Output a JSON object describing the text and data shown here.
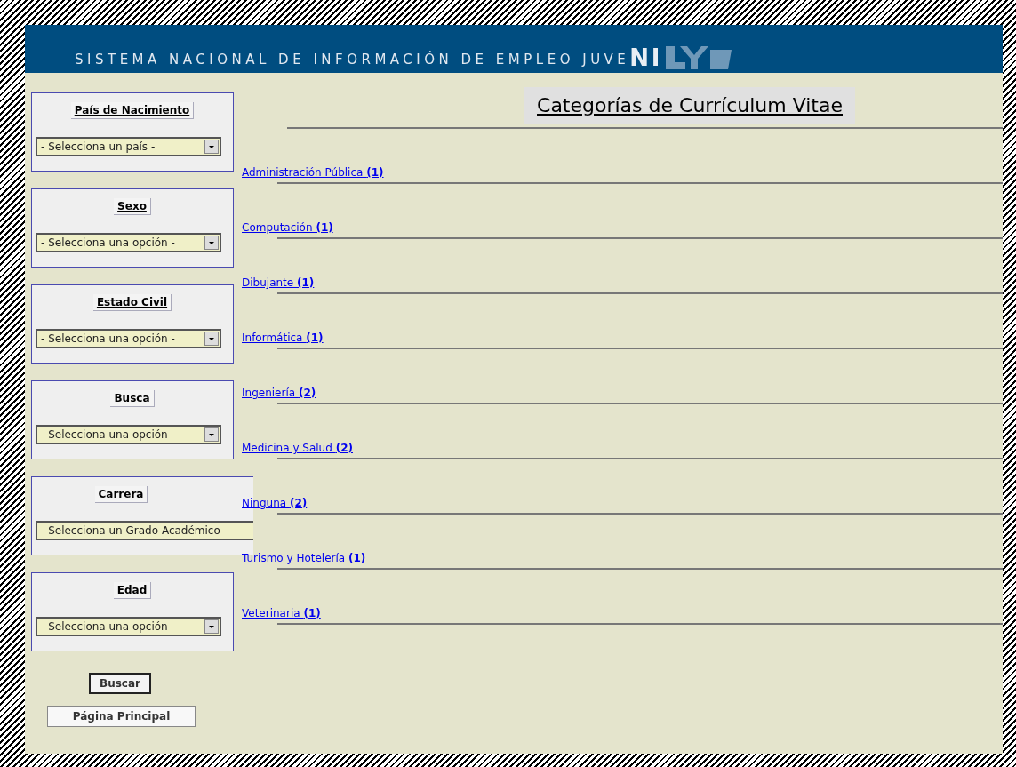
{
  "banner": {
    "title": "SISTEMA NACIONAL DE INFORMACIÓN DE EMPLEO JUVE",
    "logo_text": "NI"
  },
  "filters": [
    {
      "label": "País de Nacimiento",
      "placeholder": "- Selecciona un país -"
    },
    {
      "label": "Sexo",
      "placeholder": "- Selecciona una opción -"
    },
    {
      "label": "Estado Civil",
      "placeholder": "- Selecciona una opción -"
    },
    {
      "label": "Busca",
      "placeholder": "- Selecciona una opción -"
    },
    {
      "label": "Carrera",
      "placeholder": "- Selecciona un Grado Académico"
    },
    {
      "label": "Edad",
      "placeholder": "- Selecciona una opción -"
    }
  ],
  "search_button": "Buscar",
  "home_button": "Página Principal",
  "heading": "Categorías de Currículum Vitae",
  "categories": [
    {
      "name": "Administración Pública",
      "count": "(1)"
    },
    {
      "name": "Computación",
      "count": "(1)"
    },
    {
      "name": "Dibujante",
      "count": "(1)"
    },
    {
      "name": "Informática",
      "count": "(1)"
    },
    {
      "name": "Ingeniería",
      "count": "(2)"
    },
    {
      "name": "Medicina y Salud",
      "count": "(2)"
    },
    {
      "name": "Ninguna",
      "count": "(2)"
    },
    {
      "name": "Turismo y Hotelería",
      "count": "(1)"
    },
    {
      "name": "Veterinaria",
      "count": "(1)"
    }
  ]
}
